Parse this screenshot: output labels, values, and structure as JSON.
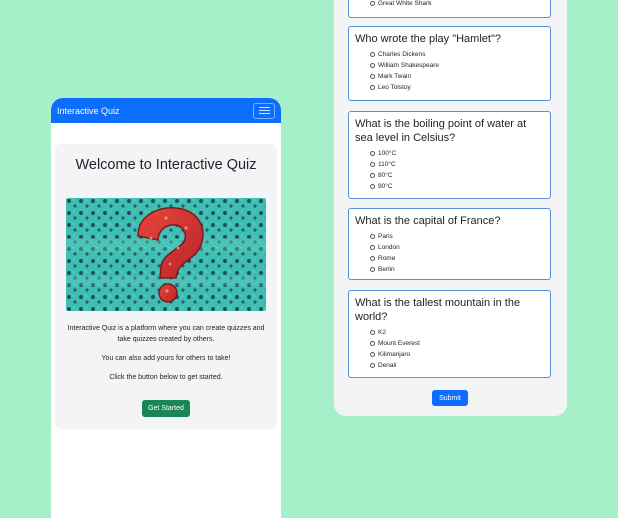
{
  "left_app": {
    "brand": "Interactive Quiz",
    "menu_icon": "hamburger-icon",
    "welcome_title": "Welcome to Interactive Quiz",
    "hero_icon": "question-mark-image",
    "paragraph1": "Interactive Quiz is a platform where you can create quizzes and take quizzes created by others.",
    "paragraph2": "You can also add yours for others to take!",
    "paragraph3": "Click the button below to get started.",
    "cta_label": "Get Started"
  },
  "quiz": {
    "partial_option": "Great White Shark",
    "questions": [
      {
        "title": "Who wrote the play \"Hamlet\"?",
        "options": [
          "Charles Dickens",
          "William Shakespeare",
          "Mark Twain",
          "Leo Tolstoy"
        ]
      },
      {
        "title": "What is the boiling point of water at sea level in Celsius?",
        "options": [
          "100°C",
          "110°C",
          "80°C",
          "90°C"
        ]
      },
      {
        "title": "What is the capital of France?",
        "options": [
          "Paris",
          "London",
          "Rome",
          "Berlin"
        ]
      },
      {
        "title": "What is the tallest mountain in the world?",
        "options": [
          "K2",
          "Mount Everest",
          "Kilimanjaro",
          "Denali"
        ]
      }
    ],
    "submit_label": "Submit"
  },
  "colors": {
    "background": "#a6f0c9",
    "primary": "#0d6efd",
    "success": "#198754",
    "card_border": "#5b8fd9"
  }
}
